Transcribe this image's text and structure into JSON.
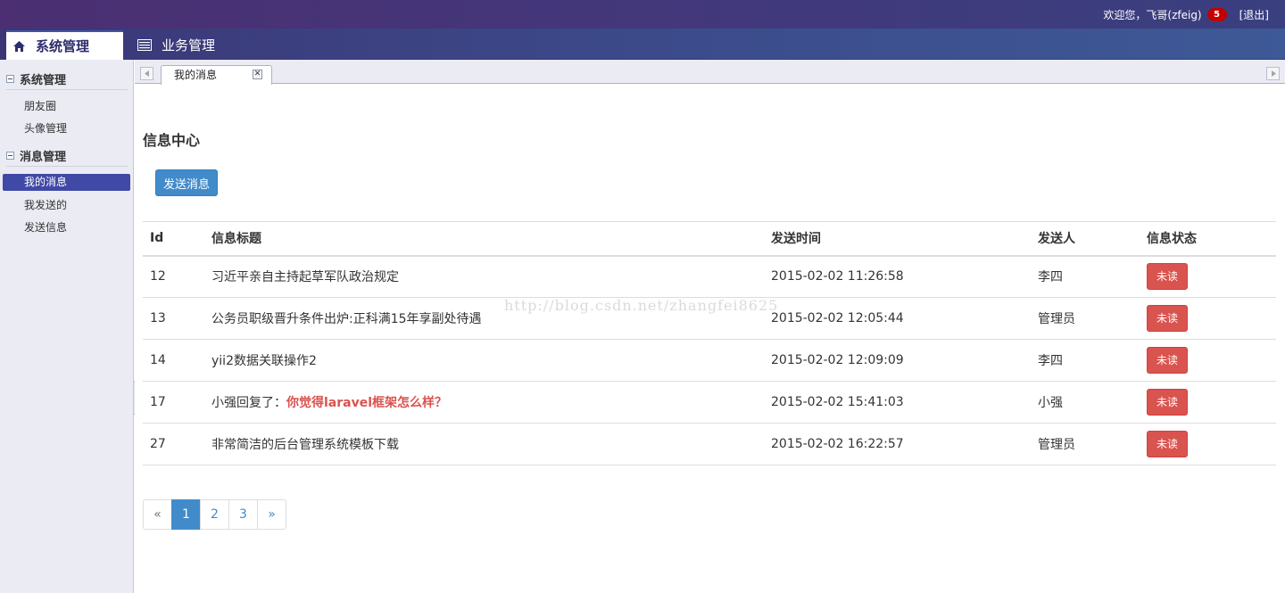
{
  "header": {
    "welcome_text": "欢迎您，飞哥(zfeig)",
    "unread_count": "5",
    "logout_label": "[退出]"
  },
  "nav": {
    "tabs": [
      {
        "label": "系统管理",
        "icon": "home-icon",
        "active": true
      },
      {
        "label": "业务管理",
        "icon": "list-icon",
        "active": false
      }
    ]
  },
  "sidebar": {
    "groups": [
      {
        "title": "系统管理",
        "items": [
          {
            "label": "朋友圈"
          },
          {
            "label": "头像管理"
          }
        ]
      },
      {
        "title": "消息管理",
        "items": [
          {
            "label": "我的消息",
            "active": true
          },
          {
            "label": "我发送的"
          },
          {
            "label": "发送信息"
          }
        ]
      }
    ]
  },
  "tabstrip": {
    "open_tab_label": "我的消息",
    "close_glyph": "✕"
  },
  "main": {
    "page_title": "信息中心",
    "send_button_label": "发送消息",
    "table": {
      "columns": [
        "Id",
        "信息标题",
        "发送时间",
        "发送人",
        "信息状态"
      ],
      "rows": [
        {
          "id": "12",
          "title": "习近平亲自主持起草军队政治规定",
          "title_highlight": "",
          "time": "2015-02-02 11:26:58",
          "sender": "李四",
          "status": "未读"
        },
        {
          "id": "13",
          "title": "公务员职级晋升条件出炉:正科满15年享副处待遇",
          "title_highlight": "",
          "time": "2015-02-02 12:05:44",
          "sender": "管理员",
          "status": "未读"
        },
        {
          "id": "14",
          "title": "yii2数据关联操作2",
          "title_highlight": "",
          "time": "2015-02-02 12:09:09",
          "sender": "李四",
          "status": "未读"
        },
        {
          "id": "17",
          "title": "小强回复了：",
          "title_highlight": "你觉得laravel框架怎么样？",
          "time": "2015-02-02 15:41:03",
          "sender": "小强",
          "status": "未读"
        },
        {
          "id": "27",
          "title": "非常简洁的后台管理系统模板下载",
          "title_highlight": "",
          "time": "2015-02-02 16:22:57",
          "sender": "管理员",
          "status": "未读"
        }
      ]
    },
    "watermark": "http://blog.csdn.net/zhangfei8625",
    "pagination": {
      "prev": "«",
      "pages": [
        "1",
        "2",
        "3"
      ],
      "active_page": "1",
      "next": "»"
    }
  },
  "colors": {
    "primary": "#428bca",
    "danger": "#d9534f",
    "sidebar_active": "#4049a6",
    "badge": "#c30000"
  }
}
